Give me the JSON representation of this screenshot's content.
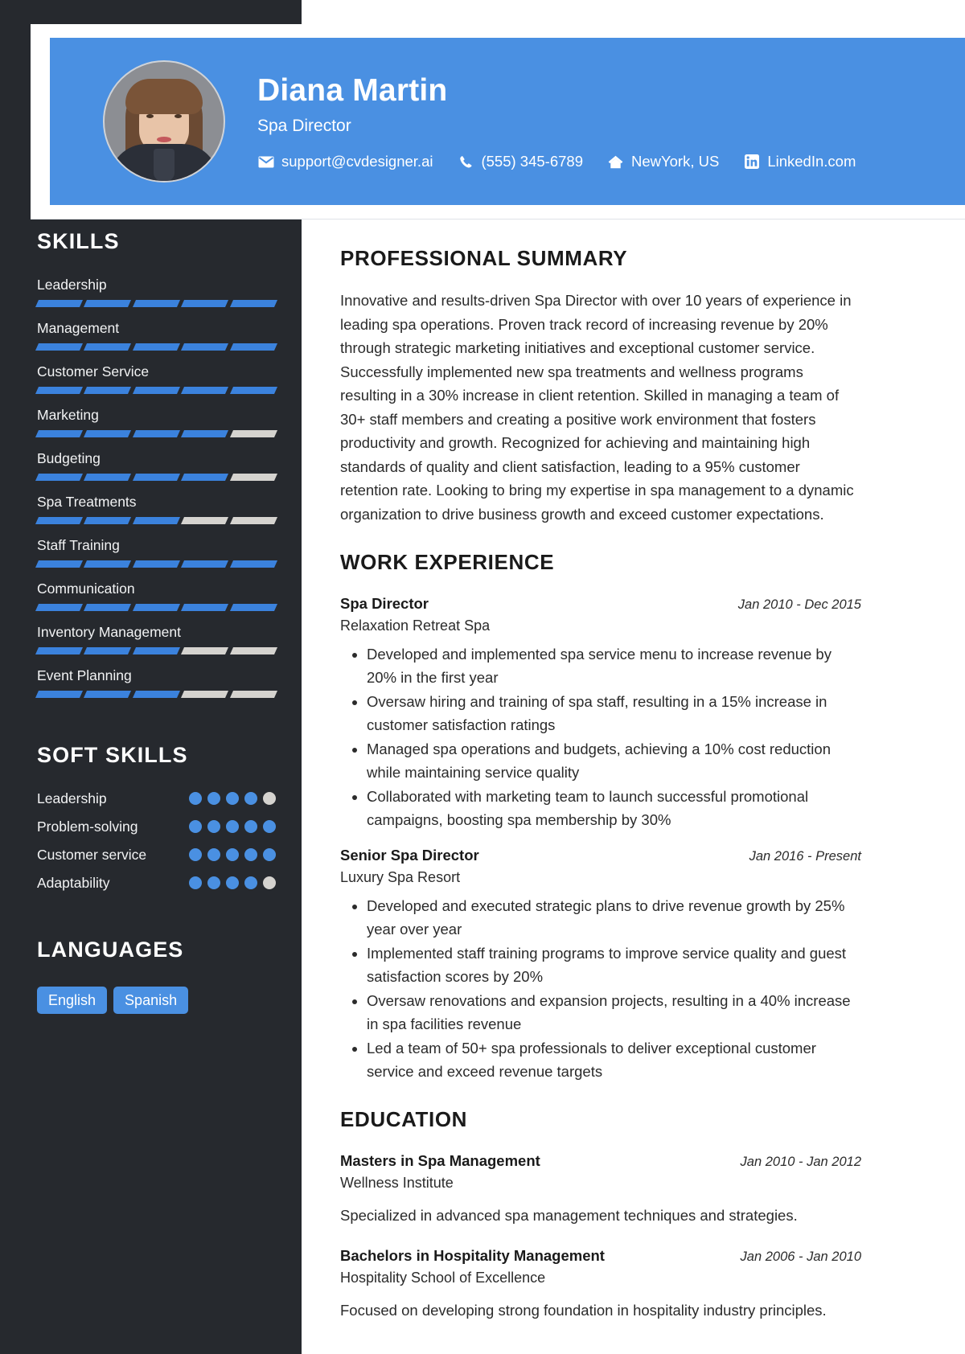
{
  "theme": {
    "accent": "#4a90e2",
    "sidebar_bg": "#26292e",
    "bar_on": "#3b82dd",
    "bar_off": "#d5d3cf"
  },
  "header": {
    "name": "Diana Martin",
    "title": "Spa Director",
    "avatar_alt": "profile-photo",
    "contacts": [
      {
        "icon": "envelope-icon",
        "text": "support@cvdesigner.ai"
      },
      {
        "icon": "phone-icon",
        "text": "(555) 345-6789"
      },
      {
        "icon": "home-icon",
        "text": "NewYork, US"
      },
      {
        "icon": "linkedin-icon",
        "text": "LinkedIn.com"
      }
    ]
  },
  "sidebar": {
    "skills_heading": "SKILLS",
    "skills": [
      {
        "name": "Leadership",
        "level": 5,
        "max": 5
      },
      {
        "name": "Management",
        "level": 5,
        "max": 5
      },
      {
        "name": "Customer Service",
        "level": 5,
        "max": 5
      },
      {
        "name": "Marketing",
        "level": 4,
        "max": 5
      },
      {
        "name": "Budgeting",
        "level": 4,
        "max": 5
      },
      {
        "name": "Spa Treatments",
        "level": 3,
        "max": 5
      },
      {
        "name": "Staff Training",
        "level": 5,
        "max": 5
      },
      {
        "name": "Communication",
        "level": 5,
        "max": 5
      },
      {
        "name": "Inventory Management",
        "level": 3,
        "max": 5
      },
      {
        "name": "Event Planning",
        "level": 3,
        "max": 5
      }
    ],
    "soft_skills_heading": "SOFT SKILLS",
    "soft_skills": [
      {
        "name": "Leadership",
        "level": 4,
        "max": 5
      },
      {
        "name": "Problem-solving",
        "level": 5,
        "max": 5
      },
      {
        "name": "Customer service",
        "level": 5,
        "max": 5
      },
      {
        "name": "Adaptability",
        "level": 4,
        "max": 5
      }
    ],
    "languages_heading": "LANGUAGES",
    "languages": [
      "English",
      "Spanish"
    ]
  },
  "main": {
    "summary_heading": "PROFESSIONAL SUMMARY",
    "summary_text": "Innovative and results-driven Spa Director with over 10 years of experience in leading spa operations. Proven track record of increasing revenue by 20% through strategic marketing initiatives and exceptional customer service. Successfully implemented new spa treatments and wellness programs resulting in a 30% increase in client retention. Skilled in managing a team of 30+ staff members and creating a positive work environment that fosters productivity and growth. Recognized for achieving and maintaining high standards of quality and client satisfaction, leading to a 95% customer retention rate. Looking to bring my expertise in spa management to a dynamic organization to drive business growth and exceed customer expectations.",
    "experience_heading": "WORK EXPERIENCE",
    "experience": [
      {
        "title": "Spa Director",
        "date": "Jan 2010 - Dec 2015",
        "org": "Relaxation Retreat Spa",
        "bullets": [
          "Developed and implemented spa service menu to increase revenue by 20% in the first year",
          "Oversaw hiring and training of spa staff, resulting in a 15% increase in customer satisfaction ratings",
          "Managed spa operations and budgets, achieving a 10% cost reduction while maintaining service quality",
          "Collaborated with marketing team to launch successful promotional campaigns, boosting spa membership by 30%"
        ]
      },
      {
        "title": "Senior Spa Director",
        "date": "Jan 2016 - Present",
        "org": "Luxury Spa Resort",
        "bullets": [
          "Developed and executed strategic plans to drive revenue growth by 25% year over year",
          "Implemented staff training programs to improve service quality and guest satisfaction scores by 20%",
          "Oversaw renovations and expansion projects, resulting in a 40% increase in spa facilities revenue",
          "Led a team of 50+ spa professionals to deliver exceptional customer service and exceed revenue targets"
        ]
      }
    ],
    "education_heading": "EDUCATION",
    "education": [
      {
        "degree": "Masters in Spa Management",
        "date": "Jan 2010 - Jan 2012",
        "school": "Wellness Institute",
        "description": "Specialized in advanced spa management techniques and strategies."
      },
      {
        "degree": "Bachelors in Hospitality Management",
        "date": "Jan 2006 - Jan 2010",
        "school": "Hospitality School of Excellence",
        "description": "Focused on developing strong foundation in hospitality industry principles."
      }
    ]
  }
}
